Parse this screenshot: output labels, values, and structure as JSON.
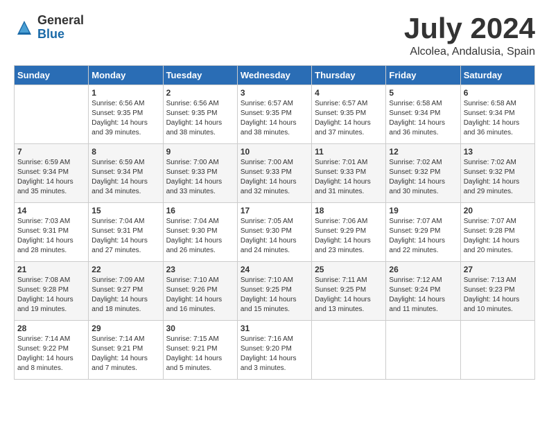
{
  "logo": {
    "general": "General",
    "blue": "Blue"
  },
  "title": "July 2024",
  "location": "Alcolea, Andalusia, Spain",
  "days_of_week": [
    "Sunday",
    "Monday",
    "Tuesday",
    "Wednesday",
    "Thursday",
    "Friday",
    "Saturday"
  ],
  "weeks": [
    [
      {
        "day": "",
        "sunrise": "",
        "sunset": "",
        "daylight": ""
      },
      {
        "day": "1",
        "sunrise": "Sunrise: 6:56 AM",
        "sunset": "Sunset: 9:35 PM",
        "daylight": "Daylight: 14 hours and 39 minutes."
      },
      {
        "day": "2",
        "sunrise": "Sunrise: 6:56 AM",
        "sunset": "Sunset: 9:35 PM",
        "daylight": "Daylight: 14 hours and 38 minutes."
      },
      {
        "day": "3",
        "sunrise": "Sunrise: 6:57 AM",
        "sunset": "Sunset: 9:35 PM",
        "daylight": "Daylight: 14 hours and 38 minutes."
      },
      {
        "day": "4",
        "sunrise": "Sunrise: 6:57 AM",
        "sunset": "Sunset: 9:35 PM",
        "daylight": "Daylight: 14 hours and 37 minutes."
      },
      {
        "day": "5",
        "sunrise": "Sunrise: 6:58 AM",
        "sunset": "Sunset: 9:34 PM",
        "daylight": "Daylight: 14 hours and 36 minutes."
      },
      {
        "day": "6",
        "sunrise": "Sunrise: 6:58 AM",
        "sunset": "Sunset: 9:34 PM",
        "daylight": "Daylight: 14 hours and 36 minutes."
      }
    ],
    [
      {
        "day": "7",
        "sunrise": "Sunrise: 6:59 AM",
        "sunset": "Sunset: 9:34 PM",
        "daylight": "Daylight: 14 hours and 35 minutes."
      },
      {
        "day": "8",
        "sunrise": "Sunrise: 6:59 AM",
        "sunset": "Sunset: 9:34 PM",
        "daylight": "Daylight: 14 hours and 34 minutes."
      },
      {
        "day": "9",
        "sunrise": "Sunrise: 7:00 AM",
        "sunset": "Sunset: 9:33 PM",
        "daylight": "Daylight: 14 hours and 33 minutes."
      },
      {
        "day": "10",
        "sunrise": "Sunrise: 7:00 AM",
        "sunset": "Sunset: 9:33 PM",
        "daylight": "Daylight: 14 hours and 32 minutes."
      },
      {
        "day": "11",
        "sunrise": "Sunrise: 7:01 AM",
        "sunset": "Sunset: 9:33 PM",
        "daylight": "Daylight: 14 hours and 31 minutes."
      },
      {
        "day": "12",
        "sunrise": "Sunrise: 7:02 AM",
        "sunset": "Sunset: 9:32 PM",
        "daylight": "Daylight: 14 hours and 30 minutes."
      },
      {
        "day": "13",
        "sunrise": "Sunrise: 7:02 AM",
        "sunset": "Sunset: 9:32 PM",
        "daylight": "Daylight: 14 hours and 29 minutes."
      }
    ],
    [
      {
        "day": "14",
        "sunrise": "Sunrise: 7:03 AM",
        "sunset": "Sunset: 9:31 PM",
        "daylight": "Daylight: 14 hours and 28 minutes."
      },
      {
        "day": "15",
        "sunrise": "Sunrise: 7:04 AM",
        "sunset": "Sunset: 9:31 PM",
        "daylight": "Daylight: 14 hours and 27 minutes."
      },
      {
        "day": "16",
        "sunrise": "Sunrise: 7:04 AM",
        "sunset": "Sunset: 9:30 PM",
        "daylight": "Daylight: 14 hours and 26 minutes."
      },
      {
        "day": "17",
        "sunrise": "Sunrise: 7:05 AM",
        "sunset": "Sunset: 9:30 PM",
        "daylight": "Daylight: 14 hours and 24 minutes."
      },
      {
        "day": "18",
        "sunrise": "Sunrise: 7:06 AM",
        "sunset": "Sunset: 9:29 PM",
        "daylight": "Daylight: 14 hours and 23 minutes."
      },
      {
        "day": "19",
        "sunrise": "Sunrise: 7:07 AM",
        "sunset": "Sunset: 9:29 PM",
        "daylight": "Daylight: 14 hours and 22 minutes."
      },
      {
        "day": "20",
        "sunrise": "Sunrise: 7:07 AM",
        "sunset": "Sunset: 9:28 PM",
        "daylight": "Daylight: 14 hours and 20 minutes."
      }
    ],
    [
      {
        "day": "21",
        "sunrise": "Sunrise: 7:08 AM",
        "sunset": "Sunset: 9:28 PM",
        "daylight": "Daylight: 14 hours and 19 minutes."
      },
      {
        "day": "22",
        "sunrise": "Sunrise: 7:09 AM",
        "sunset": "Sunset: 9:27 PM",
        "daylight": "Daylight: 14 hours and 18 minutes."
      },
      {
        "day": "23",
        "sunrise": "Sunrise: 7:10 AM",
        "sunset": "Sunset: 9:26 PM",
        "daylight": "Daylight: 14 hours and 16 minutes."
      },
      {
        "day": "24",
        "sunrise": "Sunrise: 7:10 AM",
        "sunset": "Sunset: 9:25 PM",
        "daylight": "Daylight: 14 hours and 15 minutes."
      },
      {
        "day": "25",
        "sunrise": "Sunrise: 7:11 AM",
        "sunset": "Sunset: 9:25 PM",
        "daylight": "Daylight: 14 hours and 13 minutes."
      },
      {
        "day": "26",
        "sunrise": "Sunrise: 7:12 AM",
        "sunset": "Sunset: 9:24 PM",
        "daylight": "Daylight: 14 hours and 11 minutes."
      },
      {
        "day": "27",
        "sunrise": "Sunrise: 7:13 AM",
        "sunset": "Sunset: 9:23 PM",
        "daylight": "Daylight: 14 hours and 10 minutes."
      }
    ],
    [
      {
        "day": "28",
        "sunrise": "Sunrise: 7:14 AM",
        "sunset": "Sunset: 9:22 PM",
        "daylight": "Daylight: 14 hours and 8 minutes."
      },
      {
        "day": "29",
        "sunrise": "Sunrise: 7:14 AM",
        "sunset": "Sunset: 9:21 PM",
        "daylight": "Daylight: 14 hours and 7 minutes."
      },
      {
        "day": "30",
        "sunrise": "Sunrise: 7:15 AM",
        "sunset": "Sunset: 9:21 PM",
        "daylight": "Daylight: 14 hours and 5 minutes."
      },
      {
        "day": "31",
        "sunrise": "Sunrise: 7:16 AM",
        "sunset": "Sunset: 9:20 PM",
        "daylight": "Daylight: 14 hours and 3 minutes."
      },
      {
        "day": "",
        "sunrise": "",
        "sunset": "",
        "daylight": ""
      },
      {
        "day": "",
        "sunrise": "",
        "sunset": "",
        "daylight": ""
      },
      {
        "day": "",
        "sunrise": "",
        "sunset": "",
        "daylight": ""
      }
    ]
  ]
}
